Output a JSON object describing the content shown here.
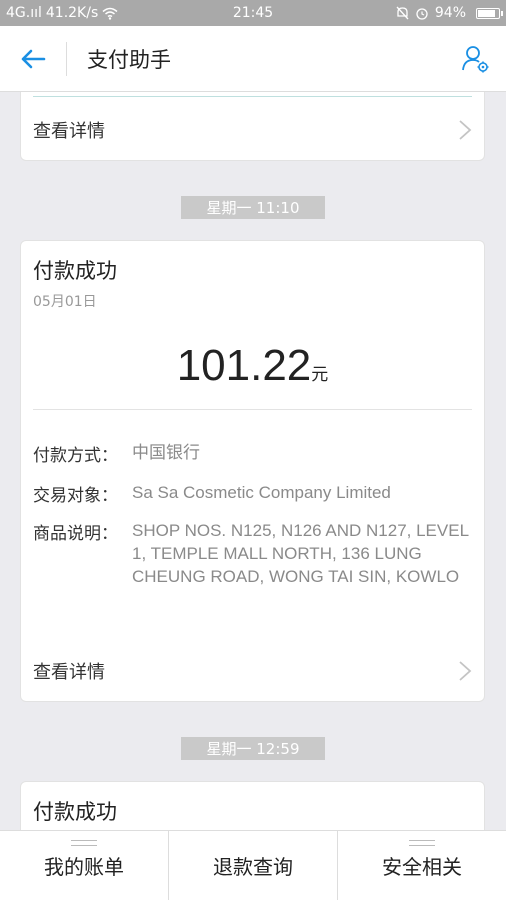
{
  "status_bar": {
    "signal": "4G.ııl",
    "speed": "41.2K/s",
    "time": "21:45",
    "battery": "94%"
  },
  "header": {
    "title": "支付助手"
  },
  "top_card": {
    "detail_label": "查看详情"
  },
  "groups": [
    {
      "date_label": "星期一 11:10",
      "card": {
        "title": "付款成功",
        "date": "05月01日",
        "amount": "101.22",
        "currency": "元",
        "payment_method_key": "付款方式：",
        "payment_method_value": "中国银行",
        "counterparty_key": "交易对象：",
        "counterparty_value": "Sa Sa Cosmetic Company Limited",
        "description_key": "商品说明：",
        "description_value": "SHOP NOS. N125, N126 AND N127, LEVEL 1, TEMPLE MALL NORTH, 136 LUNG CHEUNG ROAD, WONG TAI SIN, KOWLO",
        "detail_label": "查看详情"
      }
    },
    {
      "date_label": "星期一 12:59",
      "card": {
        "title": "付款成功"
      }
    }
  ],
  "bottom_nav": [
    {
      "label": "我的账单"
    },
    {
      "label": "退款查询"
    },
    {
      "label": "安全相关"
    }
  ],
  "colors": {
    "accent": "#1a8fe3",
    "pill": "#c9c9c9",
    "status_bar": "#a9a9a9"
  }
}
